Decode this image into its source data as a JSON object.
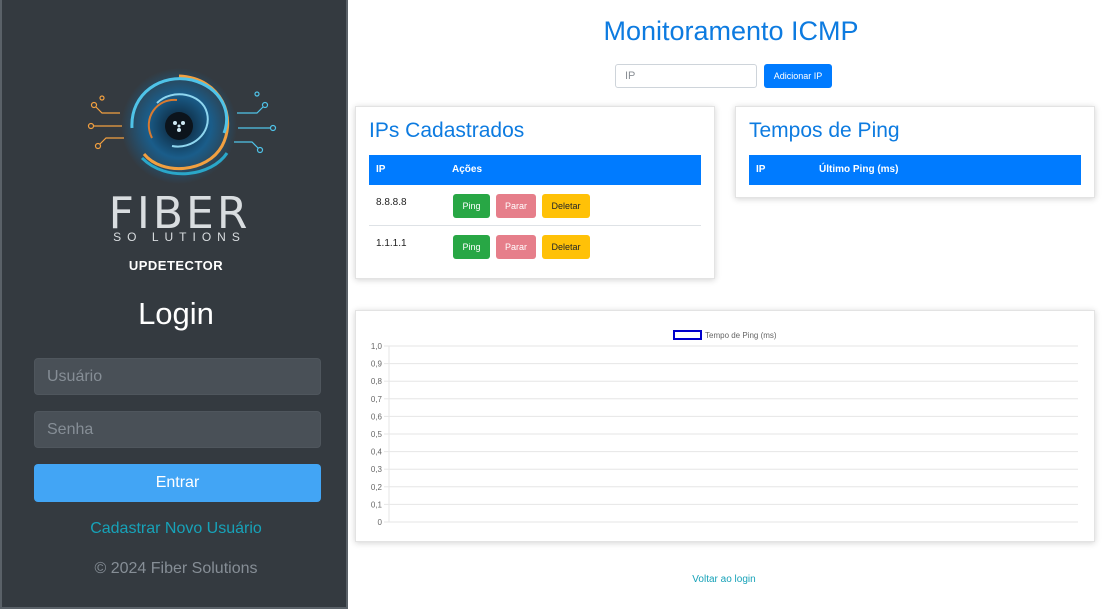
{
  "brand": {
    "logo_text": "FIBER",
    "logo_subtext": "SO LUTIONS",
    "app_name": "UPDETECTOR"
  },
  "login": {
    "title": "Login",
    "username_placeholder": "Usuário",
    "password_placeholder": "Senha",
    "submit_label": "Entrar",
    "register_link": "Cadastrar Novo Usuário",
    "copyright": "© 2024 Fiber Solutions"
  },
  "main": {
    "title": "Monitoramento ICMP",
    "ip_placeholder": "IP",
    "add_button": "Adicionar IP",
    "back_link": "Voltar ao login"
  },
  "ips_card": {
    "title": "IPs Cadastrados",
    "columns": [
      "IP",
      "Ações"
    ],
    "rows": [
      {
        "ip": "8.8.8.8",
        "ping": "Ping",
        "stop": "Parar",
        "delete": "Deletar"
      },
      {
        "ip": "1.1.1.1",
        "ping": "Ping",
        "stop": "Parar",
        "delete": "Deletar"
      }
    ]
  },
  "ping_card": {
    "title": "Tempos de Ping",
    "columns": [
      "IP",
      "Último Ping (ms)"
    ]
  },
  "colors": {
    "primary": "#007bff",
    "title_blue": "#0d7be0",
    "success": "#28a745",
    "danger_light": "#e67e8a",
    "warning": "#ffc107",
    "sidebar_bg": "#343a40",
    "link": "#17a2b8"
  },
  "chart_data": {
    "type": "line",
    "legend": [
      {
        "name": "Tempo de Ping (ms)",
        "color": "#0000cc"
      }
    ],
    "series": [
      {
        "name": "Tempo de Ping (ms)",
        "values": []
      }
    ],
    "y_ticks": [
      "1,0",
      "0,9",
      "0,8",
      "0,7",
      "0,6",
      "0,5",
      "0,4",
      "0,3",
      "0,2",
      "0,1",
      "0"
    ],
    "ylim": [
      0,
      1
    ],
    "grid": true,
    "legend_position": "top-center"
  }
}
